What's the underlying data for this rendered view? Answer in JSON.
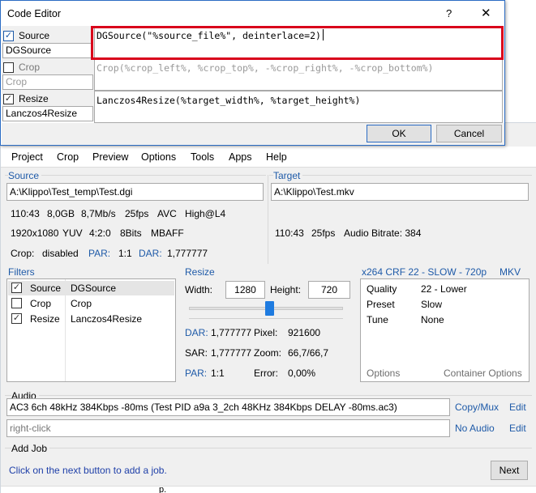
{
  "main": {
    "menu": [
      "Project",
      "Crop",
      "Preview",
      "Options",
      "Tools",
      "Apps",
      "Help"
    ],
    "source": {
      "label": "Source",
      "path": "A:\\Klippo\\Test_temp\\Test.dgi",
      "row1": [
        "110:43",
        "8,0GB",
        "8,7Mb/s",
        "25fps",
        "AVC",
        "High@L4"
      ],
      "row2": [
        "1920x1080",
        "YUV",
        "4:2:0",
        "8Bits",
        "MBAFF"
      ],
      "crop_label": "Crop:",
      "crop_value": "disabled",
      "par_label": "PAR:",
      "par_value": "1:1",
      "dar_label": "DAR:",
      "dar_value": "1,777777"
    },
    "target": {
      "label": "Target",
      "path": "A:\\Klippo\\Test.mkv",
      "duration": "110:43",
      "fps": "25fps",
      "audio_bitrate": "Audio Bitrate: 384"
    },
    "filters": {
      "label": "Filters",
      "items": [
        {
          "name": "Source",
          "value": "DGSource",
          "checked": true
        },
        {
          "name": "Crop",
          "value": "Crop",
          "checked": false
        },
        {
          "name": "Resize",
          "value": "Lanczos4Resize",
          "checked": true
        }
      ]
    },
    "resize": {
      "label": "Resize",
      "width_label": "Width:",
      "width": "1280",
      "height_label": "Height:",
      "height": "720",
      "slider_level": 0.52,
      "dar_label": "DAR:",
      "dar": "1,777777",
      "pixel_label": "Pixel:",
      "pixel": "921600",
      "sar_label": "SAR:",
      "sar": "1,777777",
      "zoom_label": "Zoom:",
      "zoom": "66,7/66,7",
      "par_label": "PAR:",
      "par": "1:1",
      "error_label": "Error:",
      "error": "0,00%"
    },
    "encoder": {
      "label": "x264 CRF 22 - SLOW - 720p",
      "container": "MKV",
      "rows": [
        {
          "k": "Quality",
          "v": "22 - Lower"
        },
        {
          "k": "Preset",
          "v": "Slow"
        },
        {
          "k": "Tune",
          "v": "None"
        }
      ],
      "options_link": "Options",
      "container_options_link": "Container Options"
    },
    "audio": {
      "label": "Audio",
      "track1": "AC3 6ch 48kHz 384Kbps -80ms (Test PID a9a 3_2ch 48KHz 384Kbps DELAY -80ms.ac3)",
      "track1_action": "Copy/Mux",
      "track1_edit": "Edit",
      "track2_placeholder": "right-click",
      "track2_action": "No Audio",
      "track2_edit": "Edit"
    },
    "add_job": {
      "label": "Add Job",
      "hint": "Click on the next button to add a job.",
      "next_button": "Next"
    }
  },
  "editor": {
    "title": "Code Editor",
    "help_button": "?",
    "close_button": "✕",
    "items": [
      {
        "label": "Source",
        "checked": true,
        "value": "DGSource",
        "code": "DGSource(\"%source_file%\", deinterlace=2)"
      },
      {
        "label": "Crop",
        "checked": false,
        "placeholder": "Crop",
        "code": "Crop(%crop_left%, %crop_top%, -%crop_right%, -%crop_bottom%)"
      },
      {
        "label": "Resize",
        "checked": true,
        "value": "Lanczos4Resize",
        "code": "Lanczos4Resize(%target_width%, %target_height%)"
      }
    ],
    "ok_button": "OK",
    "cancel_button": "Cancel",
    "highlight_color": "#d9001b"
  },
  "stray_text": "p."
}
